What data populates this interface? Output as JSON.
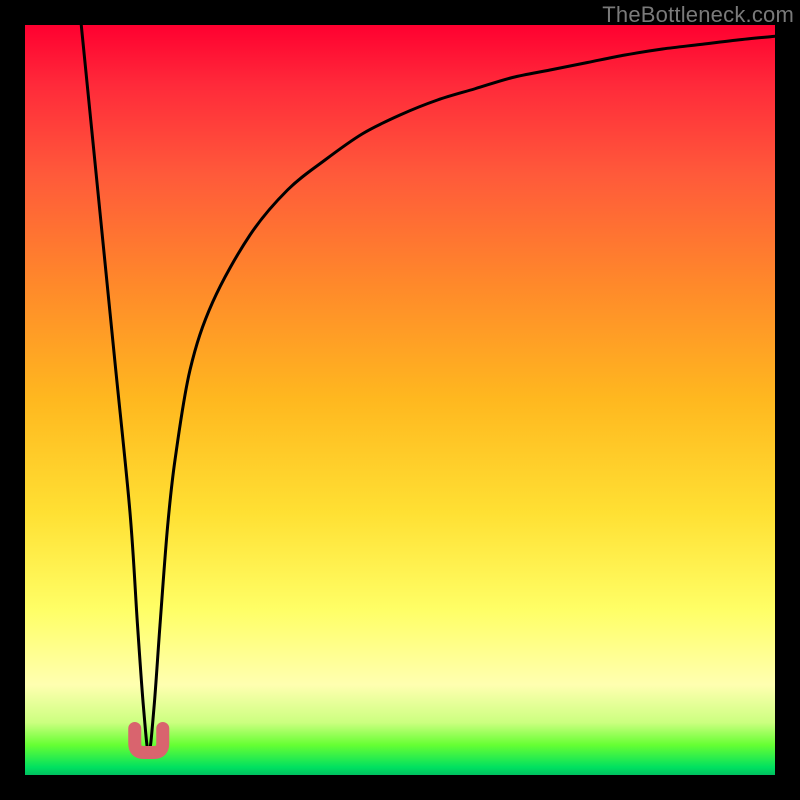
{
  "watermark": "TheBottleneck.com",
  "chart_data": {
    "type": "line",
    "title": "",
    "xlabel": "",
    "ylabel": "",
    "xlim": [
      0,
      100
    ],
    "ylim": [
      0,
      100
    ],
    "grid": false,
    "series": [
      {
        "name": "bottleneck-curve",
        "x": [
          7.5,
          10,
          12,
          14,
          15,
          15.8,
          16.5,
          17.2,
          18,
          19,
          20,
          22,
          25,
          30,
          35,
          40,
          45,
          50,
          55,
          60,
          65,
          70,
          75,
          80,
          85,
          90,
          95,
          100
        ],
        "values": [
          100,
          75,
          55,
          35,
          20,
          9,
          3,
          9,
          20,
          33,
          42,
          54,
          63,
          72,
          78,
          82,
          85.5,
          88,
          90,
          91.5,
          93,
          94,
          95,
          96,
          96.8,
          97.4,
          98,
          98.5
        ]
      }
    ],
    "marker": {
      "name": "optimal-point-marker",
      "x": 16.5,
      "y": 3,
      "shape": "u-ish",
      "color": "#d9646e"
    },
    "background_gradient": {
      "top": "#ff0030",
      "mid_upper": "#ff8a2a",
      "mid": "#ffe033",
      "mid_lower": "#ffffb0",
      "bottom": "#00c060"
    }
  }
}
